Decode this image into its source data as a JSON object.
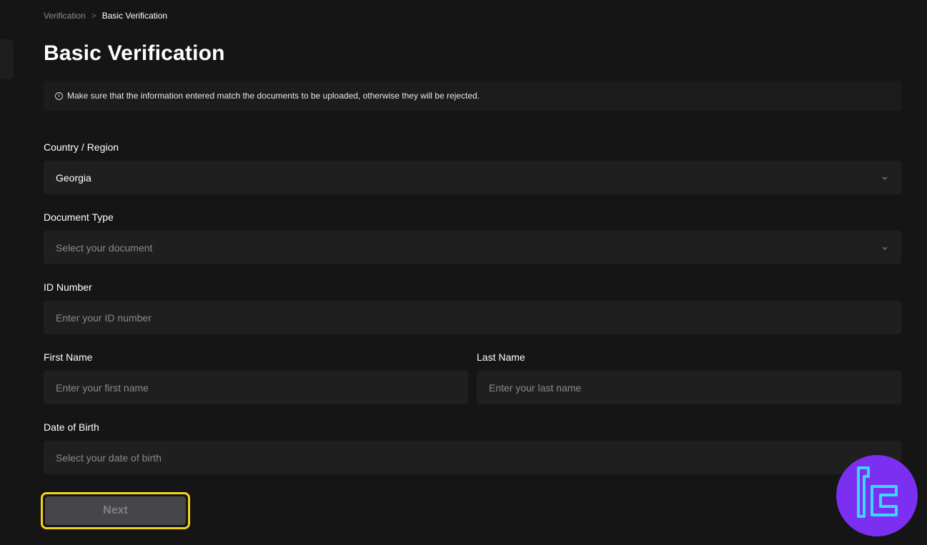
{
  "breadcrumb": {
    "parent": "Verification",
    "separator": ">",
    "current": "Basic Verification"
  },
  "page": {
    "title": "Basic Verification",
    "notice": "Make sure that the information entered match the documents to be uploaded, otherwise they will be rejected."
  },
  "form": {
    "country": {
      "label": "Country / Region",
      "value": "Georgia"
    },
    "document_type": {
      "label": "Document Type",
      "placeholder": "Select your document"
    },
    "id_number": {
      "label": "ID Number",
      "placeholder": "Enter your ID number"
    },
    "first_name": {
      "label": "First Name",
      "placeholder": "Enter your first name"
    },
    "last_name": {
      "label": "Last Name",
      "placeholder": "Enter your last name"
    },
    "date_of_birth": {
      "label": "Date of Birth",
      "placeholder": "Select your date of birth"
    }
  },
  "actions": {
    "next_label": "Next"
  },
  "icons": {
    "info": "info-icon",
    "chevron": "chevron-down-icon",
    "logo": "tc-logo-icon"
  },
  "colors": {
    "background": "#151515",
    "field": "#1f1f1f",
    "highlight": "#f7d21a",
    "logo_bg": "#7b2ff0",
    "logo_stroke": "#39d8ff"
  }
}
